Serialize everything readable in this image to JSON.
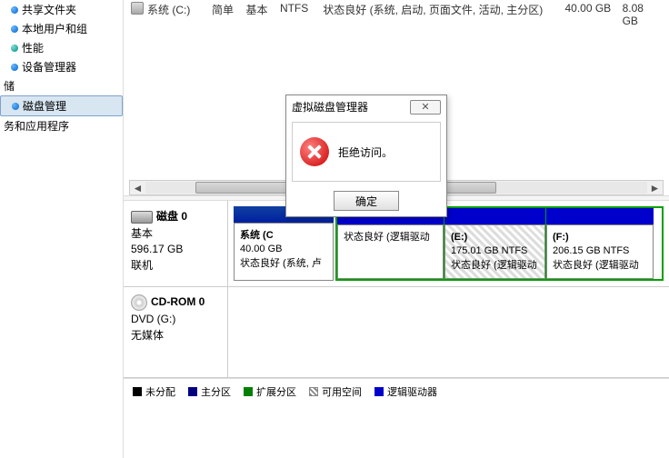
{
  "sidebar": {
    "items": [
      {
        "label": "共享文件夹",
        "indent": 1,
        "bullet": "blue"
      },
      {
        "label": "本地用户和组",
        "indent": 1,
        "bullet": "blue"
      },
      {
        "label": "性能",
        "indent": 1,
        "bullet": "teal"
      },
      {
        "label": "设备管理器",
        "indent": 1,
        "bullet": "blue"
      },
      {
        "label": "储",
        "indent": 0,
        "bullet": ""
      },
      {
        "label": "磁盘管理",
        "indent": 1,
        "bullet": "blue",
        "selected": true
      },
      {
        "label": "务和应用程序",
        "indent": 0,
        "bullet": ""
      }
    ]
  },
  "volumes": [
    {
      "name": "系统 (C:)",
      "layout": "简单",
      "type": "基本",
      "fs": "NTFS",
      "status": "状态良好 (系统, 启动, 页面文件, 活动, 主分区)",
      "capacity": "40.00 GB",
      "free": "8.08 GB"
    }
  ],
  "disks": [
    {
      "kind": "disk",
      "title": "磁盘 0",
      "lines": [
        "基本",
        "596.17 GB",
        "联机"
      ],
      "partitions": [
        {
          "label1": "系统  (C",
          "label2": "40.00 GB",
          "label3": "状态良好 (系统, 卢",
          "w": 110,
          "sel": true,
          "group": false
        },
        {
          "label1": "",
          "label2": "",
          "label3": "状态良好 (逻辑驱动",
          "w": 118,
          "group": true
        },
        {
          "label1": "(E:)",
          "label2": "175.01 GB NTFS",
          "label3": "状态良好 (逻辑驱动",
          "w": 112,
          "group": true,
          "hatched": true
        },
        {
          "label1": "(F:)",
          "label2": "206.15 GB NTFS",
          "label3": "状态良好 (逻辑驱动",
          "w": 118,
          "group": true
        }
      ]
    },
    {
      "kind": "cd",
      "title": "CD-ROM 0",
      "lines": [
        "DVD (G:)",
        "",
        "无媒体"
      ],
      "partitions": []
    }
  ],
  "legend": [
    {
      "label": "未分配",
      "sw": "black"
    },
    {
      "label": "主分区",
      "sw": "navy"
    },
    {
      "label": "扩展分区",
      "sw": "green"
    },
    {
      "label": "可用空间",
      "sw": "hatch"
    },
    {
      "label": "逻辑驱动器",
      "sw": "blue"
    }
  ],
  "dialog": {
    "title": "虚拟磁盘管理器",
    "message": "拒绝访问。",
    "ok": "确定"
  }
}
